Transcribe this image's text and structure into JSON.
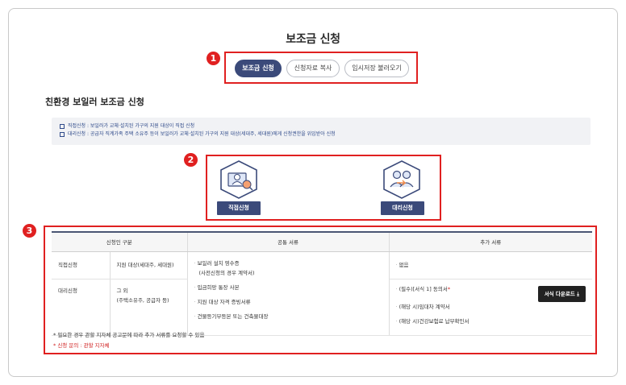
{
  "page": {
    "title": "보조금 신청",
    "tabs": [
      {
        "label": "보조금 신청",
        "active": true
      },
      {
        "label": "신청자료 복사",
        "active": false
      },
      {
        "label": "임시저장 불러오기",
        "active": false
      }
    ],
    "callouts": [
      "1",
      "2",
      "3"
    ]
  },
  "section": {
    "title": "친환경 보일러 보조금 신청",
    "notices": [
      "직접신청 : 보일러가 교체·설치된 가구의 지원 대상이 직접 신청",
      "대리신청 : 공급자 직계가족 주택 소유주 등이 보일러가 교체·설치된 가구의 지원 대상(세대주, 세대원)에게 신청권한을 위임받아 신청"
    ]
  },
  "apply": {
    "direct_label": "직접신청",
    "proxy_label": "대리신청",
    "direct_icon": "person-document-icon",
    "proxy_icon": "people-handover-icon"
  },
  "table": {
    "headers": [
      "신청인 구분",
      "공통 서류",
      "추가 서류"
    ],
    "direct": {
      "type": "직접신청",
      "target": "지원 대상(세대주, 세대원)",
      "extra": "없음"
    },
    "proxy": {
      "type": "대리신청",
      "target_line1": "그 외",
      "target_line2": "(주택소유주, 공급자 등)",
      "extra": [
        {
          "text": "(필수)[서식 1] 동의서",
          "required_mark": "*"
        },
        {
          "text": "(해당 시)임대차 계약서"
        },
        {
          "text": "(해당 시)건강보험료 납부확인서"
        }
      ],
      "download_label": "서식 다운로드",
      "download_icon": "download-icon"
    },
    "common_docs": [
      "보일러 설치 영수증",
      "(사전신청의 경우 계약서)",
      "입금희망 통장 사본",
      "지원 대상 자격 증빙서류",
      "건물등기부등본 또는 건축물대장"
    ]
  },
  "footnotes": {
    "note": "* 필요한 경우 관할 지자체 공고문에 따라 추가 서류를 요청할 수 있음",
    "inquiry": "* 신청 문의 : 관할 지자체"
  },
  "colors": {
    "accent": "#3b4a7a",
    "callout": "#e02020",
    "notice_text": "#2f4a8a"
  }
}
